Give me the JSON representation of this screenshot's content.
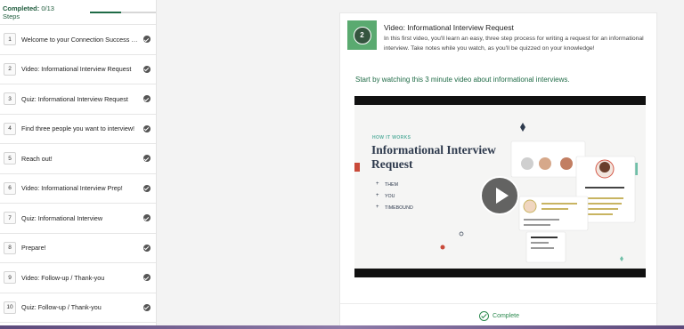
{
  "sidebar": {
    "completed_label": "Completed:",
    "completed_value": "0/13 Steps",
    "progress_fraction": 0.47,
    "steps": [
      {
        "num": "1",
        "title": "Welcome to your Connection Success Pat..."
      },
      {
        "num": "2",
        "title": "Video: Informational Interview Request"
      },
      {
        "num": "3",
        "title": "Quiz: Informational Interview Request"
      },
      {
        "num": "4",
        "title": "Find three people you want to interview!"
      },
      {
        "num": "5",
        "title": "Reach out!"
      },
      {
        "num": "6",
        "title": "Video: Informational Interview Prep!"
      },
      {
        "num": "7",
        "title": "Quiz: Informational Interview"
      },
      {
        "num": "8",
        "title": "Prepare!"
      },
      {
        "num": "9",
        "title": "Video: Follow-up / Thank-you"
      },
      {
        "num": "10",
        "title": "Quiz: Follow-up / Thank-you"
      }
    ]
  },
  "lesson": {
    "badge": "2",
    "title": "Video: Informational Interview Request",
    "description": "In this first video, you'll learn an easy, three step process for writing a request for an informational interview. Take notes while you watch, as you'll be quizzed on your knowledge!",
    "intro": "Start by watching this 3 minute video about informational interviews."
  },
  "video": {
    "eyebrow": "HOW IT WORKS",
    "title": "Informational Interview Request",
    "bullets": [
      "THEM",
      "YOU",
      "TIMEBOUND"
    ],
    "card_title": "Recommended for you",
    "profile_name": "Gloria Vasquez",
    "profile_role": "Product Manager · Cobalt"
  },
  "footer": {
    "complete_label": "Complete"
  },
  "colors": {
    "accent": "#1f6b46",
    "badge": "#5aaa70",
    "complete": "#2c8a4f"
  }
}
